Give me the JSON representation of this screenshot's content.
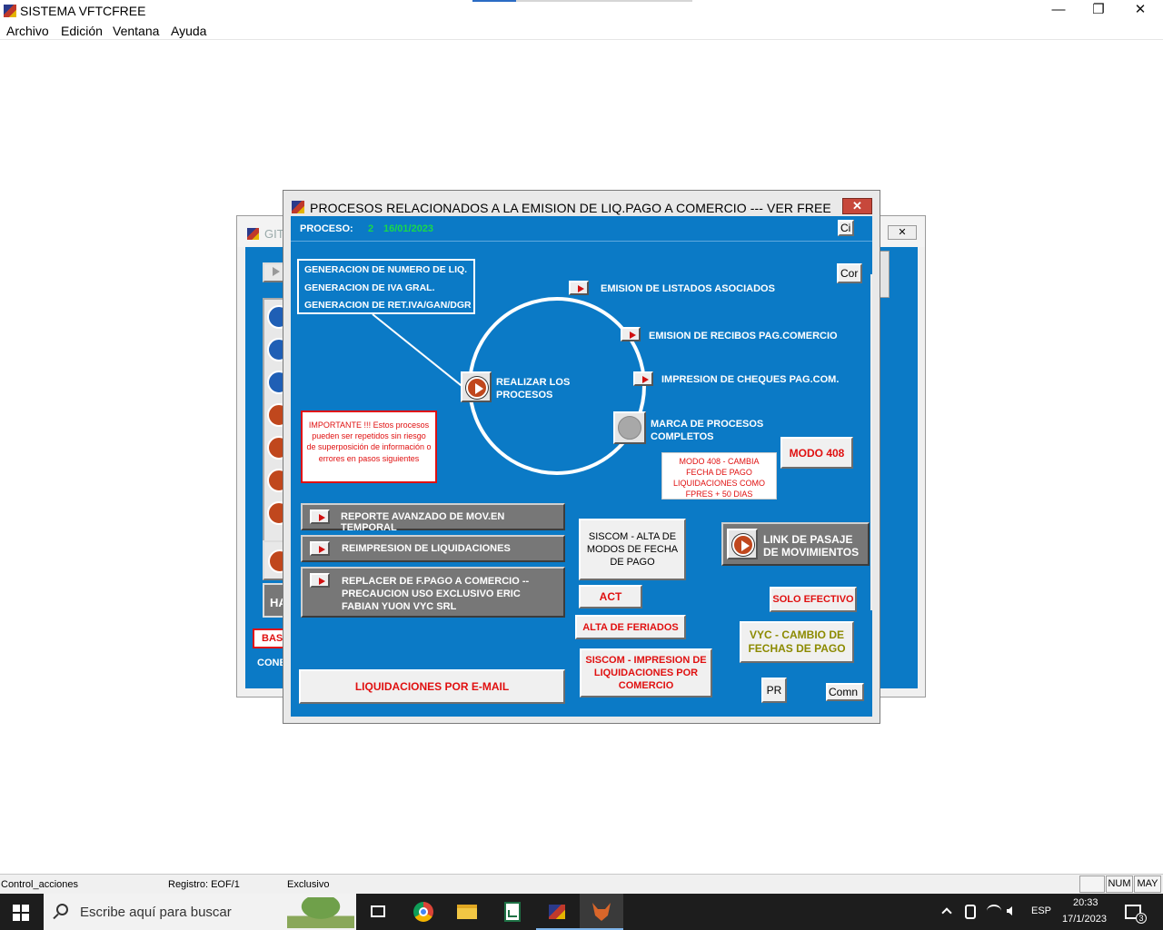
{
  "app": {
    "title": "SISTEMA VFTCFREE",
    "menu": [
      "Archivo",
      "Edición",
      "Ventana",
      "Ayuda"
    ],
    "minimize": "—",
    "restore": "❐",
    "close": "✕"
  },
  "bg_window": {
    "title": "GIT",
    "close": "✕",
    "left_labels": {
      "ha": "HA",
      "bas": "BAS",
      "cone": "CONE"
    }
  },
  "dialog": {
    "title": "PROCESOS  RELACIONADOS A LA EMISION DE LIQ.PAGO A COMERCIO ---  VER FREE",
    "close": "✕",
    "proceso_label": "PROCESO:",
    "proceso_num": "2",
    "proceso_fecha": "16/01/2023",
    "ci_btn": "Ci",
    "cor_btn": "Cor",
    "gen_box": [
      "GENERACION DE NUMERO DE LIQ.",
      "GENERACION DE IVA GRAL.",
      "GENERACION DE RET.IVA/GAN/DGR"
    ],
    "realizar": "REALIZAR LOS PROCESOS",
    "emision_listados": "EMISION DE LISTADOS ASOCIADOS",
    "emision_recibos": "EMISION DE RECIBOS PAG.COMERCIO",
    "impresion_cheques": "IMPRESION DE CHEQUES PAG.COM.",
    "marca_procesos": "MARCA DE PROCESOS COMPLETOS",
    "importante": "IMPORTANTE !!! Estos procesos pueden ser repetidos sin riesgo de superposición de información o errores en pasos siguientes",
    "modo408_note": "MODO 408 - CAMBIA FECHA DE PAGO LIQUIDACIONES COMO FPRES + 50 DIAS",
    "modo408_btn": "MODO 408",
    "reporte": "REPORTE AVANZADO DE MOV.EN TEMPORAL",
    "reimpresion": "REIMPRESION DE LIQUIDACIONES",
    "replacer": "REPLACER DE F.PAGO A COMERCIO  -- PRECAUCION USO EXCLUSIVO ERIC FABIAN YUON VYC SRL",
    "siscom_alta": "SISCOM -  ALTA DE MODOS DE FECHA DE PAGO",
    "act": "ACT",
    "alta_feriados": "ALTA DE FERIADOS",
    "siscom_impresion": "SISCOM - IMPRESION DE LIQUIDACIONES POR COMERCIO",
    "link_pasaje": "LINK DE PASAJE DE MOVIMIENTOS",
    "solo_efectivo": "SOLO EFECTIVO",
    "vyc_cambio": "VYC  - CAMBIO DE FECHAS DE PAGO",
    "liquidaciones_email": "LIQUIDACIONES POR E-MAIL",
    "pr": "PR",
    "comn": "Comn"
  },
  "statusbar": {
    "control": "Control_acciones",
    "registro": "Registro: EOF/1",
    "modo": "Exclusivo",
    "num": "NUM",
    "may": "MAY"
  },
  "taskbar": {
    "search_placeholder": "Escribe aquí para buscar",
    "lang": "ESP",
    "time": "20:33",
    "date": "17/1/2023",
    "notif": "3"
  },
  "colors": {
    "dialog_bg": "#0b7ac6",
    "red_text": "#e01010",
    "green_date": "#19d84a",
    "olive_text": "#8c8a00"
  }
}
